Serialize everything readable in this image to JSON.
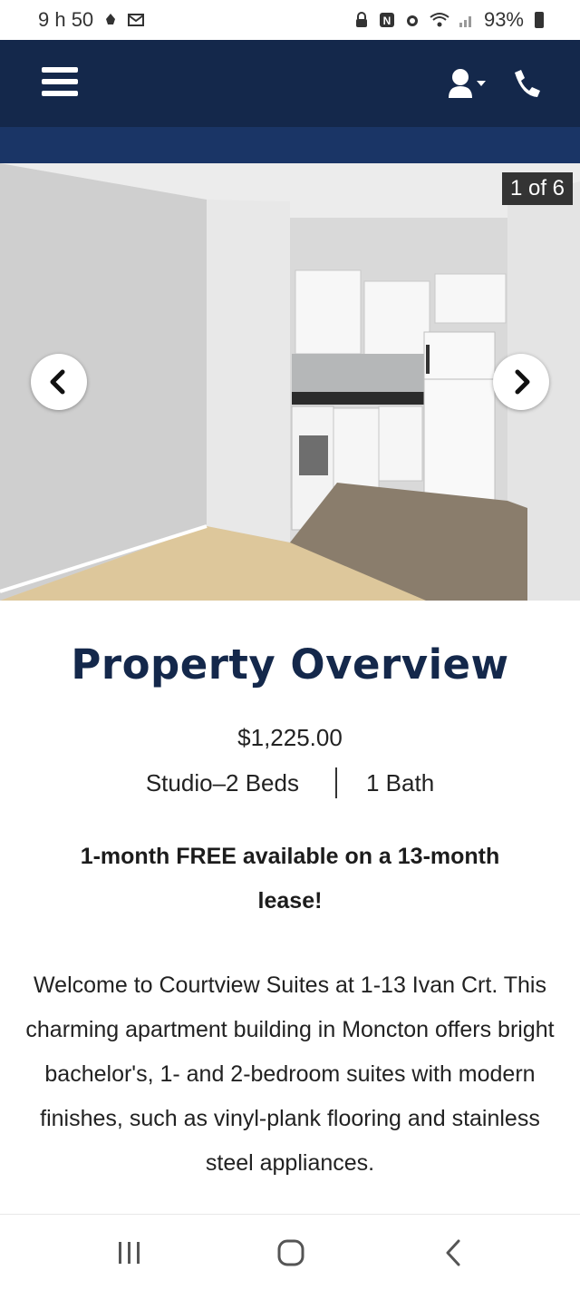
{
  "status_bar": {
    "time": "9 h 50",
    "battery": "93%"
  },
  "header": {
    "menu_icon": "hamburger-menu-icon",
    "account_icon": "user-icon",
    "phone_icon": "phone-icon"
  },
  "gallery": {
    "counter": "1 of 6",
    "prev_icon": "chevron-left-icon",
    "next_icon": "chevron-right-icon"
  },
  "overview": {
    "title": "Property Overview",
    "price": "$1,225.00",
    "beds": "Studio–2 Beds",
    "baths": "1 Bath",
    "promo": "1-month FREE available on a 13-month lease!",
    "description": "Welcome to Courtview Suites at 1-13 Ivan Crt. This charming apartment building in Moncton offers bright bachelor's, 1- and 2-bedroom suites with modern finishes, such as vinyl-plank flooring and stainless steel appliances."
  },
  "colors": {
    "header_bg": "#14284b",
    "subheader_bg": "#1a3566",
    "title_color": "#14284b"
  }
}
